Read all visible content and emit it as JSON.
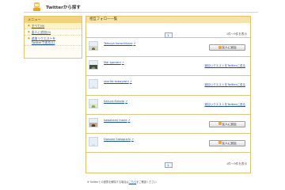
{
  "header": {
    "title": "Twitterから探す"
  },
  "sidebar": {
    "heading": "メニュー",
    "items": [
      {
        "label": "すべて(9)",
        "active": true
      },
      {
        "label": "友人に追加(3)",
        "active": false
      },
      {
        "label": "追加リクエストを",
        "label2": "Twitterで送る(1)",
        "active": false
      }
    ]
  },
  "main": {
    "heading": "相互フォロー一覧",
    "pager_current": "1",
    "count_text": "1件～9件を表示",
    "add_button_label": "友人に追加",
    "invite_label": "追加リクエストをTwitterに送る",
    "users": [
      {
        "name": "Tetsuya horachibara",
        "action": "add"
      },
      {
        "name": "Mai Igarashi",
        "action": "invite"
      },
      {
        "name": "shorita kobayashi",
        "action": "invite"
      },
      {
        "name": "Sakura Kimoto",
        "action": "invite"
      },
      {
        "name": "kawakami marie",
        "action": "add"
      },
      {
        "name": "Daisuke Sakaguchi",
        "action": "add"
      }
    ]
  },
  "footnote": {
    "text": "※ Twitterとの連携を解除する場合は",
    "link": "こちら",
    "tail": "をご確認ください"
  },
  "colors": {
    "accent": "#f2d27a",
    "link": "#1d4fa8",
    "border": "#e2c16a"
  }
}
